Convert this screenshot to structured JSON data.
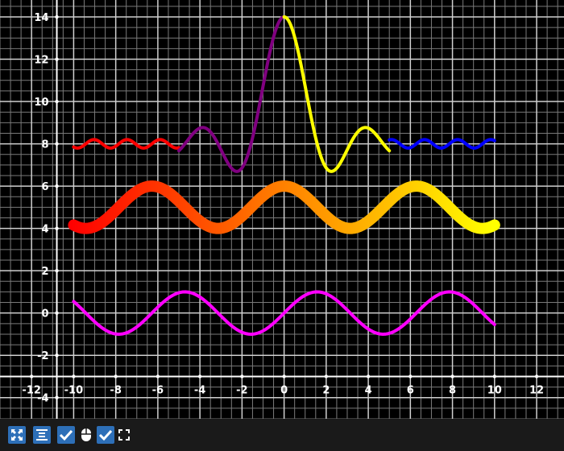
{
  "chart_data": {
    "type": "line",
    "title": "",
    "xlabel": "",
    "ylabel": "",
    "xlim": [
      -13.5,
      13.3
    ],
    "ylim": [
      -5,
      14.8
    ],
    "grid": {
      "major": 2,
      "minor": 0.5
    },
    "x_ticks": [
      "-12",
      "-10",
      "-8",
      "-6",
      "-4",
      "-2",
      "0",
      "2",
      "4",
      "6",
      "8",
      "10",
      "12"
    ],
    "y_ticks": [
      "-4",
      "-2",
      "0",
      "2",
      "4",
      "6",
      "8",
      "10",
      "12",
      "14"
    ],
    "x_tick_values": [
      -12,
      -10,
      -8,
      -6,
      -4,
      -2,
      0,
      2,
      4,
      6,
      8,
      10,
      12
    ],
    "y_tick_values": [
      -4,
      -2,
      0,
      2,
      4,
      6,
      8,
      10,
      12,
      14
    ],
    "series": [
      {
        "formula": "y = 8 + 0.2*sin(x*4)",
        "x_range": [
          -10,
          -5
        ],
        "color": "#ff0000",
        "width": 4
      },
      {
        "formula": "y = 8 + 3*sin(2x)/x",
        "x_range": [
          -5,
          0
        ],
        "color": "#800080",
        "width": 4
      },
      {
        "formula": "y = 8 + 3*sin(2x)/x",
        "x_range": [
          0,
          5
        ],
        "color": "#ffff00",
        "width": 4
      },
      {
        "formula": "y = 8 + 0.2*sin(x*4)",
        "x_range": [
          5,
          10
        ],
        "color": "#0000ff",
        "width": 4
      },
      {
        "formula": "y = 5 + cos(x)",
        "x_range": [
          -10,
          10
        ],
        "color_start": "#ff0000",
        "color_end": "#ffff00",
        "width": 14
      },
      {
        "formula": "y = sin(x)",
        "x_range": [
          -10,
          10
        ],
        "color": "#ff00ff",
        "width": 4
      }
    ]
  },
  "toolbar": {
    "items": [
      {
        "name": "zoom-fit-icon",
        "style": "blue"
      },
      {
        "name": "align-center-icon",
        "style": "blue"
      },
      {
        "name": "mouse-checkbox",
        "style": "blue",
        "checked": true
      },
      {
        "name": "mouse-icon",
        "style": "plain"
      },
      {
        "name": "fullscreen-checkbox",
        "style": "blue",
        "checked": true
      },
      {
        "name": "fullscreen-icon",
        "style": "plain"
      }
    ]
  }
}
